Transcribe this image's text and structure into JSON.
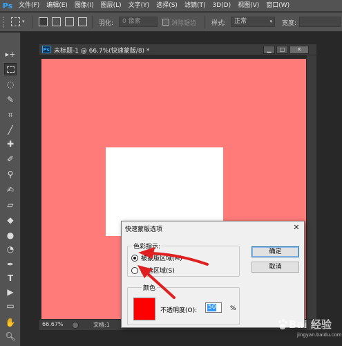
{
  "app": {
    "logo": "Ps",
    "menu": [
      "文件(F)",
      "编辑(E)",
      "图像(I)",
      "图层(L)",
      "文字(Y)",
      "选择(S)",
      "滤镜(T)",
      "3D(D)",
      "视图(V)",
      "窗口(W)"
    ]
  },
  "options": {
    "feather_label": "羽化:",
    "feather_value": "0 像素",
    "antialias_label": "消除锯齿",
    "style_label": "样式:",
    "style_value": "正常",
    "width_label": "宽度:"
  },
  "tools": [
    "move-tool",
    "marquee-tool",
    "lasso-tool",
    "quick-select-tool",
    "crop-tool",
    "eyedropper-tool",
    "healing-brush-tool",
    "brush-tool",
    "clone-stamp-tool",
    "history-brush-tool",
    "eraser-tool",
    "paint-bucket-tool",
    "blur-tool",
    "dodge-tool",
    "pen-tool",
    "type-tool",
    "path-select-tool",
    "shape-tool",
    "hand-tool",
    "zoom-tool"
  ],
  "document": {
    "title": "未标题-1 @ 66.7%(快速蒙版/8) *",
    "zoom": "66.67%",
    "info": "文档:1",
    "canvas_color": "#ff7b7a"
  },
  "dialog": {
    "title": "快速蒙版选项",
    "color_indicates_label": "色彩指示:",
    "option_masked": "被蒙版区域(M)",
    "option_selected": "所选区域(S)",
    "selected_option": "masked",
    "color_group_label": "颜色",
    "opacity_label": "不透明度(O):",
    "opacity_value": "50",
    "opacity_unit": "%",
    "ok_button": "确定",
    "cancel_button": "取消",
    "mask_color": "#fe0000"
  },
  "watermark": {
    "main": "Bai 经验",
    "sub": "jingyan.baidu.com"
  },
  "colors": {
    "annotation_arrow": "#e02020",
    "ps_blue": "#31a8ff"
  }
}
